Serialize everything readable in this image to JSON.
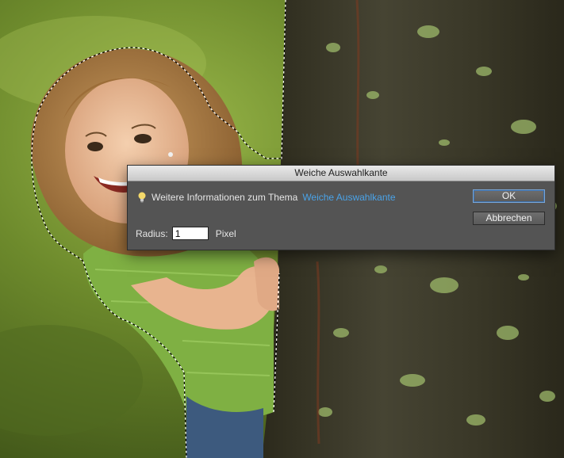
{
  "dialog": {
    "title": "Weiche Auswahlkante",
    "info_text": "Weitere Informationen zum Thema",
    "info_link": "Weiche Auswahlkante",
    "radius_label": "Radius:",
    "radius_value": "1",
    "radius_unit": "Pixel",
    "ok_label": "OK",
    "cancel_label": "Abbrechen"
  },
  "colors": {
    "dialog_bg": "#545454",
    "link": "#4aa3e8",
    "grass": "#6f8f2e",
    "bark": "#3b3a2a",
    "lichen": "#9db96a",
    "shirt": "#7fb043"
  },
  "icons": {
    "info": "lightbulb-icon"
  }
}
